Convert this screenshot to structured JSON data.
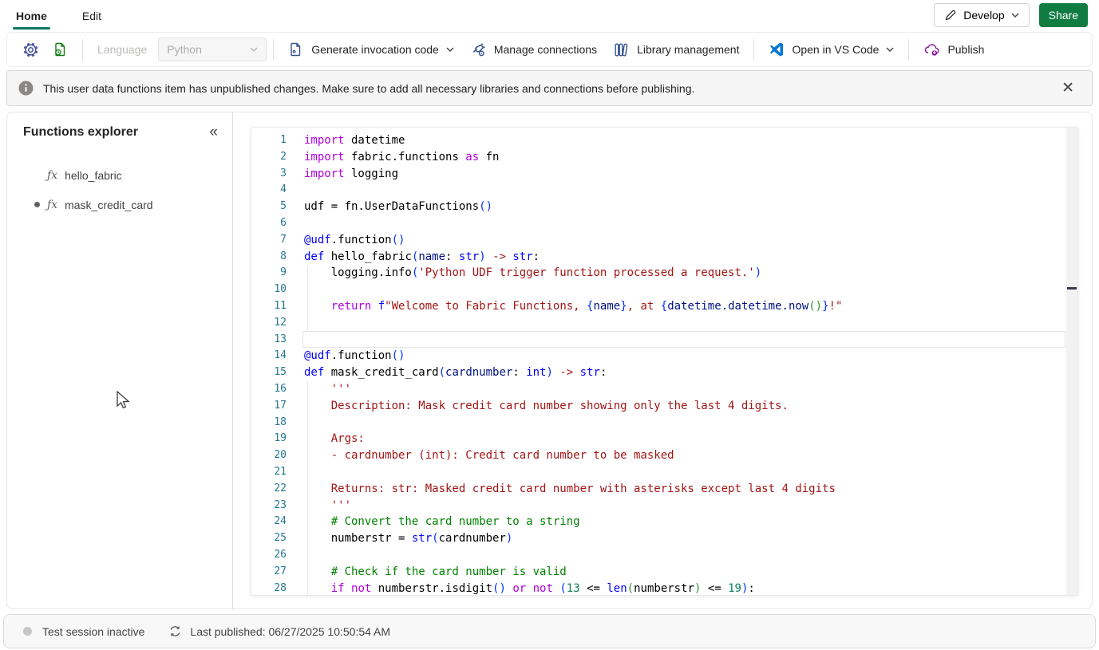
{
  "tabs": {
    "home": "Home",
    "edit": "Edit"
  },
  "header": {
    "develop_label": "Develop",
    "share_label": "Share"
  },
  "toolbar": {
    "language_label": "Language",
    "language_value": "Python",
    "generate_label": "Generate invocation code",
    "connections_label": "Manage connections",
    "library_label": "Library management",
    "vscode_label": "Open in VS Code",
    "publish_label": "Publish"
  },
  "banner": {
    "message": "This user data functions item has unpublished changes. Make sure to add all necessary libraries and connections before publishing."
  },
  "sidebar": {
    "title": "Functions explorer",
    "items": [
      {
        "label": "hello_fabric",
        "modified": false
      },
      {
        "label": "mask_credit_card",
        "modified": true
      }
    ]
  },
  "editor": {
    "language": "python",
    "current_line": 13,
    "lines": [
      [
        [
          "k",
          "import"
        ],
        [
          "p",
          " datetime"
        ]
      ],
      [
        [
          "k",
          "import"
        ],
        [
          "p",
          " fabric.functions "
        ],
        [
          "k",
          "as"
        ],
        [
          "p",
          " fn"
        ]
      ],
      [
        [
          "k",
          "import"
        ],
        [
          "p",
          " logging"
        ]
      ],
      [],
      [
        [
          "p",
          "udf = fn.UserDataFunctions"
        ],
        [
          "b1",
          "()"
        ]
      ],
      [],
      [
        [
          "d",
          "@udf"
        ],
        [
          "p",
          ".function"
        ],
        [
          "b1",
          "()"
        ]
      ],
      [
        [
          "d",
          "def"
        ],
        [
          "p",
          " hello_fabric"
        ],
        [
          "b1",
          "("
        ],
        [
          "v",
          "name"
        ],
        [
          "p",
          ": "
        ],
        [
          "d",
          "str"
        ],
        [
          "b1",
          ")"
        ],
        [
          "p",
          " "
        ],
        [
          "a",
          "->"
        ],
        [
          "p",
          " "
        ],
        [
          "d",
          "str"
        ],
        [
          "p",
          ":"
        ]
      ],
      [
        [
          "p",
          "    logging.info"
        ],
        [
          "b1",
          "("
        ],
        [
          "s",
          "'Python UDF trigger function processed a request.'"
        ],
        [
          "b1",
          ")"
        ]
      ],
      [],
      [
        [
          "p",
          "    "
        ],
        [
          "k",
          "return"
        ],
        [
          "p",
          " "
        ],
        [
          "d",
          "f"
        ],
        [
          "s",
          "\"Welcome to Fabric Functions, "
        ],
        [
          "b1",
          "{"
        ],
        [
          "v",
          "name"
        ],
        [
          "b1",
          "}"
        ],
        [
          "s",
          ", at "
        ],
        [
          "b1",
          "{"
        ],
        [
          "v",
          "datetime.datetime.now"
        ],
        [
          "b2",
          "()"
        ],
        [
          "b1",
          "}"
        ],
        [
          "s",
          "!\""
        ]
      ],
      [],
      [],
      [
        [
          "d",
          "@udf"
        ],
        [
          "p",
          ".function"
        ],
        [
          "b1",
          "()"
        ]
      ],
      [
        [
          "d",
          "def"
        ],
        [
          "p",
          " mask_credit_card"
        ],
        [
          "b1",
          "("
        ],
        [
          "v",
          "cardnumber"
        ],
        [
          "p",
          ": "
        ],
        [
          "d",
          "int"
        ],
        [
          "b1",
          ")"
        ],
        [
          "p",
          " "
        ],
        [
          "a",
          "->"
        ],
        [
          "p",
          " "
        ],
        [
          "d",
          "str"
        ],
        [
          "p",
          ":"
        ]
      ],
      [
        [
          "s",
          "    '''"
        ]
      ],
      [
        [
          "s",
          "    Description: Mask credit card number showing only the last 4 digits."
        ]
      ],
      [],
      [
        [
          "s",
          "    Args:"
        ]
      ],
      [
        [
          "s",
          "    - cardnumber (int): Credit card number to be masked"
        ]
      ],
      [],
      [
        [
          "s",
          "    Returns: str: Masked credit card number with asterisks except last 4 digits"
        ]
      ],
      [
        [
          "s",
          "    '''"
        ]
      ],
      [
        [
          "c",
          "    # Convert the card number to a string"
        ]
      ],
      [
        [
          "p",
          "    numberstr = "
        ],
        [
          "d",
          "str"
        ],
        [
          "b1",
          "("
        ],
        [
          "p",
          "cardnumber"
        ],
        [
          "b1",
          ")"
        ]
      ],
      [],
      [
        [
          "c",
          "    # Check if the card number is valid"
        ]
      ],
      [
        [
          "p",
          "    "
        ],
        [
          "k",
          "if"
        ],
        [
          "p",
          " "
        ],
        [
          "k",
          "not"
        ],
        [
          "p",
          " numberstr.isdigit"
        ],
        [
          "b1",
          "()"
        ],
        [
          "p",
          " "
        ],
        [
          "k",
          "or"
        ],
        [
          "p",
          " "
        ],
        [
          "k",
          "not"
        ],
        [
          "p",
          " "
        ],
        [
          "b1",
          "("
        ],
        [
          "n",
          "13"
        ],
        [
          "p",
          " <= "
        ],
        [
          "d",
          "len"
        ],
        [
          "b2",
          "("
        ],
        [
          "p",
          "numberstr"
        ],
        [
          "b2",
          ")"
        ],
        [
          "p",
          " <= "
        ],
        [
          "n",
          "19"
        ],
        [
          "b1",
          ")"
        ],
        [
          "p",
          ":"
        ]
      ]
    ]
  },
  "statusbar": {
    "session": "Test session inactive",
    "published": "Last published: 06/27/2025 10:50:54 AM"
  },
  "colors": {
    "accent_teal": "#117865",
    "share_green": "#107C41",
    "vscode_blue": "#007ACC",
    "publish_purple": "#881798",
    "icon_navy": "#33518e",
    "line_number": "#237893"
  }
}
